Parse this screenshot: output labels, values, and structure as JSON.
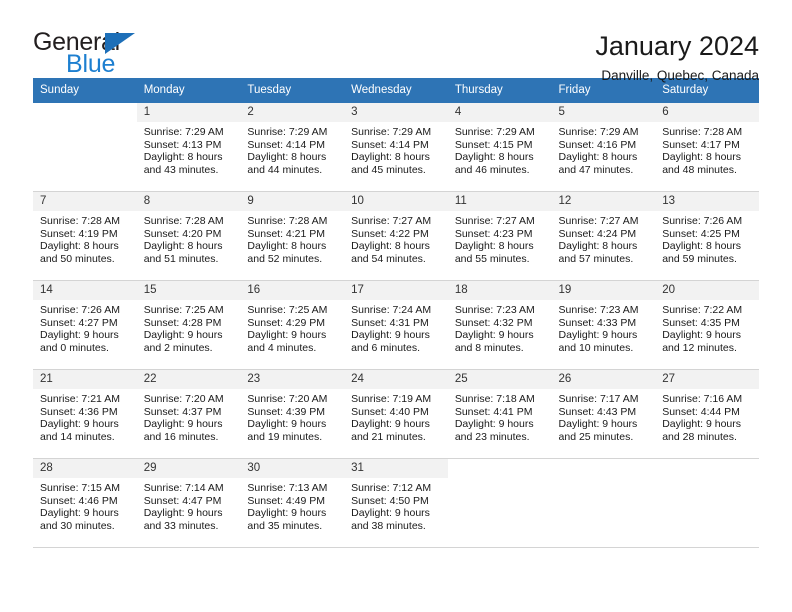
{
  "brand": {
    "name_part1": "General",
    "name_part2": "Blue",
    "triangle_color": "#1d6fb8",
    "blue_color": "#1d7fd0"
  },
  "header": {
    "title": "January 2024",
    "location": "Danville, Quebec, Canada"
  },
  "theme": {
    "header_bg": "#2e74b5",
    "daynum_bg": "#f2f2f2",
    "row_divider": "#d4d4d4",
    "text": "#1a1a1a"
  },
  "weekday_headers": [
    "Sunday",
    "Monday",
    "Tuesday",
    "Wednesday",
    "Thursday",
    "Friday",
    "Saturday"
  ],
  "weeks": [
    [
      {
        "day": "",
        "sunrise": "",
        "sunset": "",
        "daylight1": "",
        "daylight2": ""
      },
      {
        "day": "1",
        "sunrise": "Sunrise: 7:29 AM",
        "sunset": "Sunset: 4:13 PM",
        "daylight1": "Daylight: 8 hours",
        "daylight2": "and 43 minutes."
      },
      {
        "day": "2",
        "sunrise": "Sunrise: 7:29 AM",
        "sunset": "Sunset: 4:14 PM",
        "daylight1": "Daylight: 8 hours",
        "daylight2": "and 44 minutes."
      },
      {
        "day": "3",
        "sunrise": "Sunrise: 7:29 AM",
        "sunset": "Sunset: 4:14 PM",
        "daylight1": "Daylight: 8 hours",
        "daylight2": "and 45 minutes."
      },
      {
        "day": "4",
        "sunrise": "Sunrise: 7:29 AM",
        "sunset": "Sunset: 4:15 PM",
        "daylight1": "Daylight: 8 hours",
        "daylight2": "and 46 minutes."
      },
      {
        "day": "5",
        "sunrise": "Sunrise: 7:29 AM",
        "sunset": "Sunset: 4:16 PM",
        "daylight1": "Daylight: 8 hours",
        "daylight2": "and 47 minutes."
      },
      {
        "day": "6",
        "sunrise": "Sunrise: 7:28 AM",
        "sunset": "Sunset: 4:17 PM",
        "daylight1": "Daylight: 8 hours",
        "daylight2": "and 48 minutes."
      }
    ],
    [
      {
        "day": "7",
        "sunrise": "Sunrise: 7:28 AM",
        "sunset": "Sunset: 4:19 PM",
        "daylight1": "Daylight: 8 hours",
        "daylight2": "and 50 minutes."
      },
      {
        "day": "8",
        "sunrise": "Sunrise: 7:28 AM",
        "sunset": "Sunset: 4:20 PM",
        "daylight1": "Daylight: 8 hours",
        "daylight2": "and 51 minutes."
      },
      {
        "day": "9",
        "sunrise": "Sunrise: 7:28 AM",
        "sunset": "Sunset: 4:21 PM",
        "daylight1": "Daylight: 8 hours",
        "daylight2": "and 52 minutes."
      },
      {
        "day": "10",
        "sunrise": "Sunrise: 7:27 AM",
        "sunset": "Sunset: 4:22 PM",
        "daylight1": "Daylight: 8 hours",
        "daylight2": "and 54 minutes."
      },
      {
        "day": "11",
        "sunrise": "Sunrise: 7:27 AM",
        "sunset": "Sunset: 4:23 PM",
        "daylight1": "Daylight: 8 hours",
        "daylight2": "and 55 minutes."
      },
      {
        "day": "12",
        "sunrise": "Sunrise: 7:27 AM",
        "sunset": "Sunset: 4:24 PM",
        "daylight1": "Daylight: 8 hours",
        "daylight2": "and 57 minutes."
      },
      {
        "day": "13",
        "sunrise": "Sunrise: 7:26 AM",
        "sunset": "Sunset: 4:25 PM",
        "daylight1": "Daylight: 8 hours",
        "daylight2": "and 59 minutes."
      }
    ],
    [
      {
        "day": "14",
        "sunrise": "Sunrise: 7:26 AM",
        "sunset": "Sunset: 4:27 PM",
        "daylight1": "Daylight: 9 hours",
        "daylight2": "and 0 minutes."
      },
      {
        "day": "15",
        "sunrise": "Sunrise: 7:25 AM",
        "sunset": "Sunset: 4:28 PM",
        "daylight1": "Daylight: 9 hours",
        "daylight2": "and 2 minutes."
      },
      {
        "day": "16",
        "sunrise": "Sunrise: 7:25 AM",
        "sunset": "Sunset: 4:29 PM",
        "daylight1": "Daylight: 9 hours",
        "daylight2": "and 4 minutes."
      },
      {
        "day": "17",
        "sunrise": "Sunrise: 7:24 AM",
        "sunset": "Sunset: 4:31 PM",
        "daylight1": "Daylight: 9 hours",
        "daylight2": "and 6 minutes."
      },
      {
        "day": "18",
        "sunrise": "Sunrise: 7:23 AM",
        "sunset": "Sunset: 4:32 PM",
        "daylight1": "Daylight: 9 hours",
        "daylight2": "and 8 minutes."
      },
      {
        "day": "19",
        "sunrise": "Sunrise: 7:23 AM",
        "sunset": "Sunset: 4:33 PM",
        "daylight1": "Daylight: 9 hours",
        "daylight2": "and 10 minutes."
      },
      {
        "day": "20",
        "sunrise": "Sunrise: 7:22 AM",
        "sunset": "Sunset: 4:35 PM",
        "daylight1": "Daylight: 9 hours",
        "daylight2": "and 12 minutes."
      }
    ],
    [
      {
        "day": "21",
        "sunrise": "Sunrise: 7:21 AM",
        "sunset": "Sunset: 4:36 PM",
        "daylight1": "Daylight: 9 hours",
        "daylight2": "and 14 minutes."
      },
      {
        "day": "22",
        "sunrise": "Sunrise: 7:20 AM",
        "sunset": "Sunset: 4:37 PM",
        "daylight1": "Daylight: 9 hours",
        "daylight2": "and 16 minutes."
      },
      {
        "day": "23",
        "sunrise": "Sunrise: 7:20 AM",
        "sunset": "Sunset: 4:39 PM",
        "daylight1": "Daylight: 9 hours",
        "daylight2": "and 19 minutes."
      },
      {
        "day": "24",
        "sunrise": "Sunrise: 7:19 AM",
        "sunset": "Sunset: 4:40 PM",
        "daylight1": "Daylight: 9 hours",
        "daylight2": "and 21 minutes."
      },
      {
        "day": "25",
        "sunrise": "Sunrise: 7:18 AM",
        "sunset": "Sunset: 4:41 PM",
        "daylight1": "Daylight: 9 hours",
        "daylight2": "and 23 minutes."
      },
      {
        "day": "26",
        "sunrise": "Sunrise: 7:17 AM",
        "sunset": "Sunset: 4:43 PM",
        "daylight1": "Daylight: 9 hours",
        "daylight2": "and 25 minutes."
      },
      {
        "day": "27",
        "sunrise": "Sunrise: 7:16 AM",
        "sunset": "Sunset: 4:44 PM",
        "daylight1": "Daylight: 9 hours",
        "daylight2": "and 28 minutes."
      }
    ],
    [
      {
        "day": "28",
        "sunrise": "Sunrise: 7:15 AM",
        "sunset": "Sunset: 4:46 PM",
        "daylight1": "Daylight: 9 hours",
        "daylight2": "and 30 minutes."
      },
      {
        "day": "29",
        "sunrise": "Sunrise: 7:14 AM",
        "sunset": "Sunset: 4:47 PM",
        "daylight1": "Daylight: 9 hours",
        "daylight2": "and 33 minutes."
      },
      {
        "day": "30",
        "sunrise": "Sunrise: 7:13 AM",
        "sunset": "Sunset: 4:49 PM",
        "daylight1": "Daylight: 9 hours",
        "daylight2": "and 35 minutes."
      },
      {
        "day": "31",
        "sunrise": "Sunrise: 7:12 AM",
        "sunset": "Sunset: 4:50 PM",
        "daylight1": "Daylight: 9 hours",
        "daylight2": "and 38 minutes."
      },
      {
        "day": "",
        "sunrise": "",
        "sunset": "",
        "daylight1": "",
        "daylight2": ""
      },
      {
        "day": "",
        "sunrise": "",
        "sunset": "",
        "daylight1": "",
        "daylight2": ""
      },
      {
        "day": "",
        "sunrise": "",
        "sunset": "",
        "daylight1": "",
        "daylight2": ""
      }
    ]
  ]
}
